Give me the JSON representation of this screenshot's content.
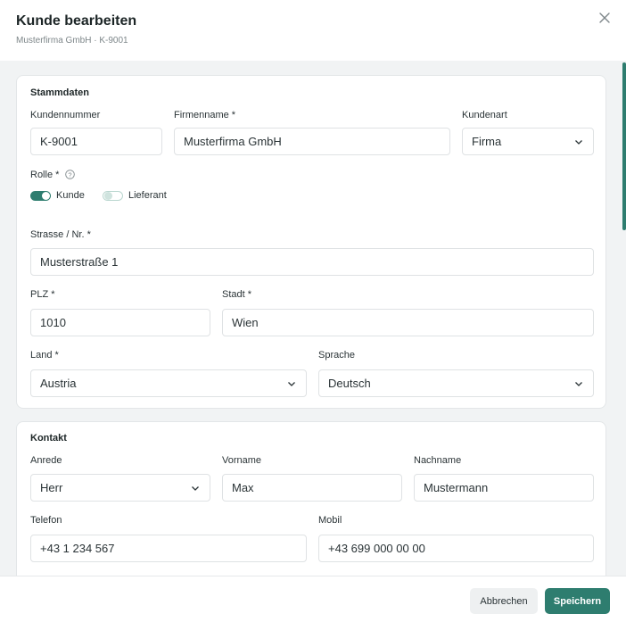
{
  "dialog": {
    "title": "Kunde bearbeiten",
    "subtitle": "Musterfirma GmbH · K-9001",
    "close_icon": "close-icon"
  },
  "stammdaten": {
    "title": "Stammdaten",
    "kundennummer": {
      "label": "Kundennummer",
      "value": "K-9001"
    },
    "firmenname": {
      "label": "Firmenname *",
      "value": "Musterfirma GmbH"
    },
    "kundenart": {
      "label": "Kundenart",
      "value": "Firma"
    },
    "rolle": {
      "label": "Rolle *",
      "options": [
        {
          "label": "Kunde",
          "checked": true
        },
        {
          "label": "Lieferant",
          "checked": false
        }
      ]
    },
    "strasse": {
      "label": "Strasse / Nr. *",
      "value": "Musterstraße 1"
    },
    "plz": {
      "label": "PLZ *",
      "value": "1010"
    },
    "stadt": {
      "label": "Stadt *",
      "value": "Wien"
    },
    "land": {
      "label": "Land *",
      "value": "Austria"
    },
    "sprache": {
      "label": "Sprache",
      "value": "Deutsch"
    }
  },
  "kontakt": {
    "title": "Kontakt",
    "anrede": {
      "label": "Anrede",
      "value": "Herr"
    },
    "vorname": {
      "label": "Vorname",
      "value": "Max"
    },
    "nachname": {
      "label": "Nachname",
      "value": "Mustermann"
    },
    "telefon": {
      "label": "Telefon",
      "value": "+43 1 234 567"
    },
    "mobil": {
      "label": "Mobil",
      "value": "+43 699 000 00 00"
    }
  },
  "footer": {
    "cancel_label": "Abbrechen",
    "save_label": "Speichern"
  },
  "colors": {
    "accent": "#2e7d6f",
    "background": "#f1f3f4"
  }
}
